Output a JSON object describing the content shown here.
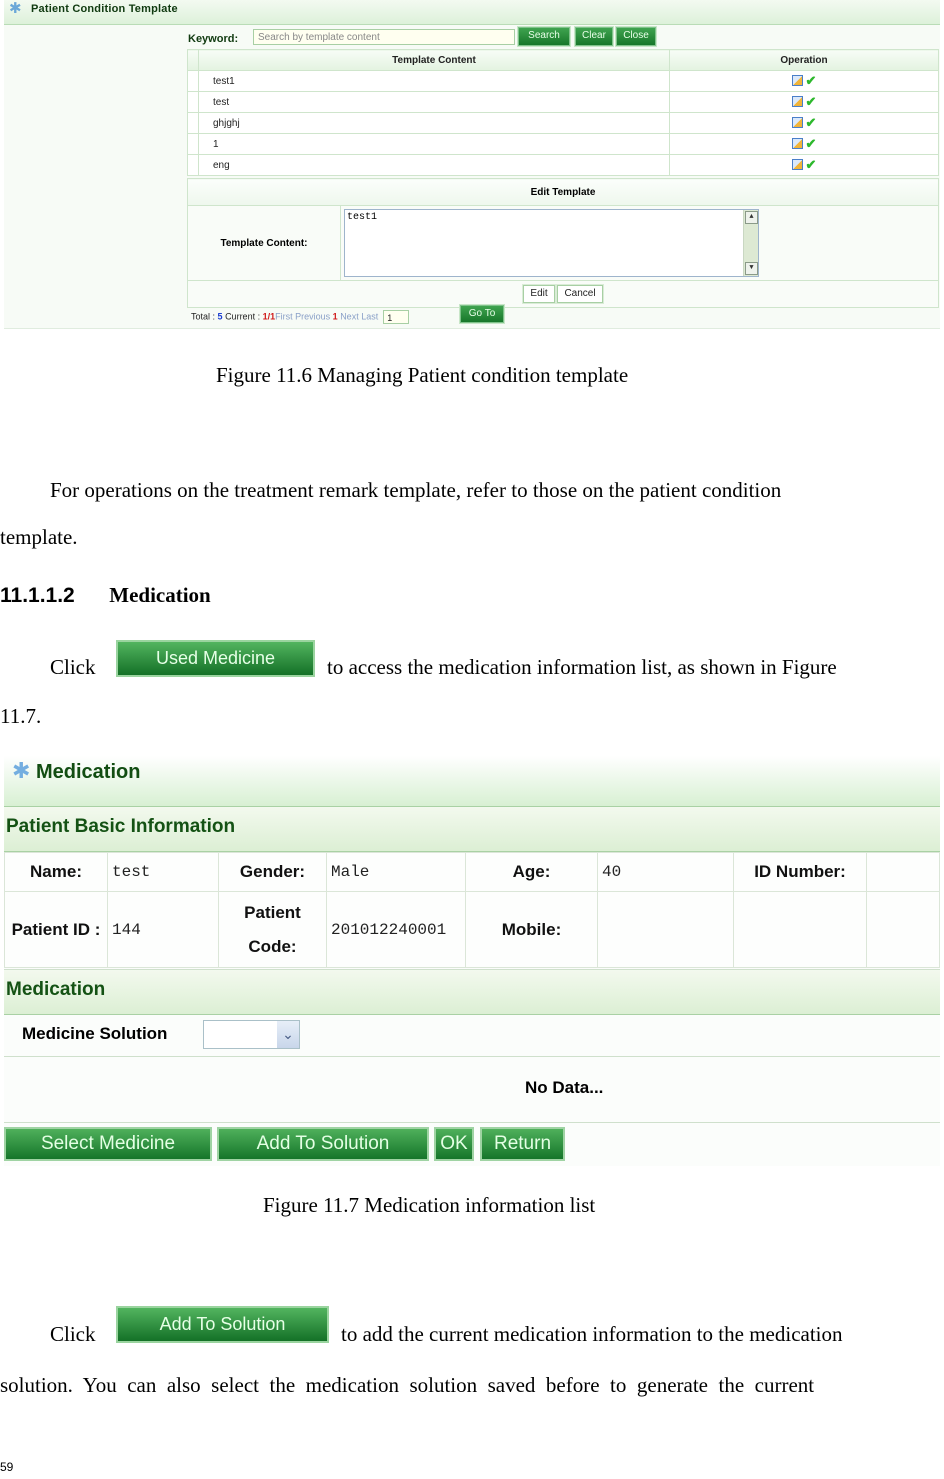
{
  "figure1": {
    "window_title": "Patient Condition Template",
    "keyword_label": "Keyword:",
    "search_placeholder": "Search by template content",
    "buttons": {
      "search": "Search",
      "clear": "Clear",
      "close": "Close"
    },
    "columns": [
      "Template Content",
      "Operation"
    ],
    "rows": [
      {
        "content": "test1"
      },
      {
        "content": "test"
      },
      {
        "content": "ghjghj"
      },
      {
        "content": "1"
      },
      {
        "content": "eng"
      }
    ],
    "icons": {
      "edit": "edit-icon",
      "select": "check-icon"
    },
    "edit_panel": {
      "title": "Edit Template",
      "content_label": "Template Content:",
      "content_value": "test1",
      "edit_button": "Edit",
      "cancel_button": "Cancel"
    },
    "pager": {
      "total_label": "Total :",
      "total": "5",
      "current_label": "Current :",
      "current": "1/1",
      "first": "First",
      "previous": "Previous",
      "page": "1",
      "next": "Next",
      "last": "Last",
      "goto_value": "1",
      "goto_button": "Go To"
    },
    "caption": "Figure 11.6 Managing Patient condition template"
  },
  "body": {
    "para1_line1": "For operations on the treatment remark template, refer to those on the patient condition",
    "para1_line2": "template.",
    "heading_number": "11.1.1.2",
    "heading_title": "Medication",
    "click_word": "Click",
    "used_medicine_button": "Used Medicine",
    "para2_rest": "to access the medication information list, as shown in Figure",
    "para2_line2": "11.7.",
    "add_to_solution_button": "Add To Solution",
    "para3_rest": "to add the current medication information to the medication",
    "para3_line2": "solution.  You  can  also  select  the  medication  solution  saved  before  to  generate  the  current"
  },
  "figure2": {
    "window_title": "Medication",
    "basic_info_title": "Patient Basic Information",
    "fields": {
      "name_label": "Name:",
      "name_value": "test",
      "gender_label": "Gender:",
      "gender_value": "Male",
      "age_label": "Age:",
      "age_value": "40",
      "id_number_label": "ID Number:",
      "id_number_value": "",
      "patient_id_label": "Patient ID :",
      "patient_id_value": "144",
      "patient_code_label_1": "Patient",
      "patient_code_label_2": "Code:",
      "patient_code_value": "201012240001",
      "mobile_label": "Mobile:",
      "mobile_value": ""
    },
    "medication_title": "Medication",
    "medicine_solution_label": "Medicine Solution",
    "medicine_solution_value": "",
    "no_data": "No Data...",
    "buttons": {
      "select_medicine": "Select Medicine",
      "add_to_solution": "Add To Solution",
      "ok": "OK",
      "return": "Return"
    },
    "caption": "Figure 11.7 Medication information list"
  },
  "page_number": "59"
}
